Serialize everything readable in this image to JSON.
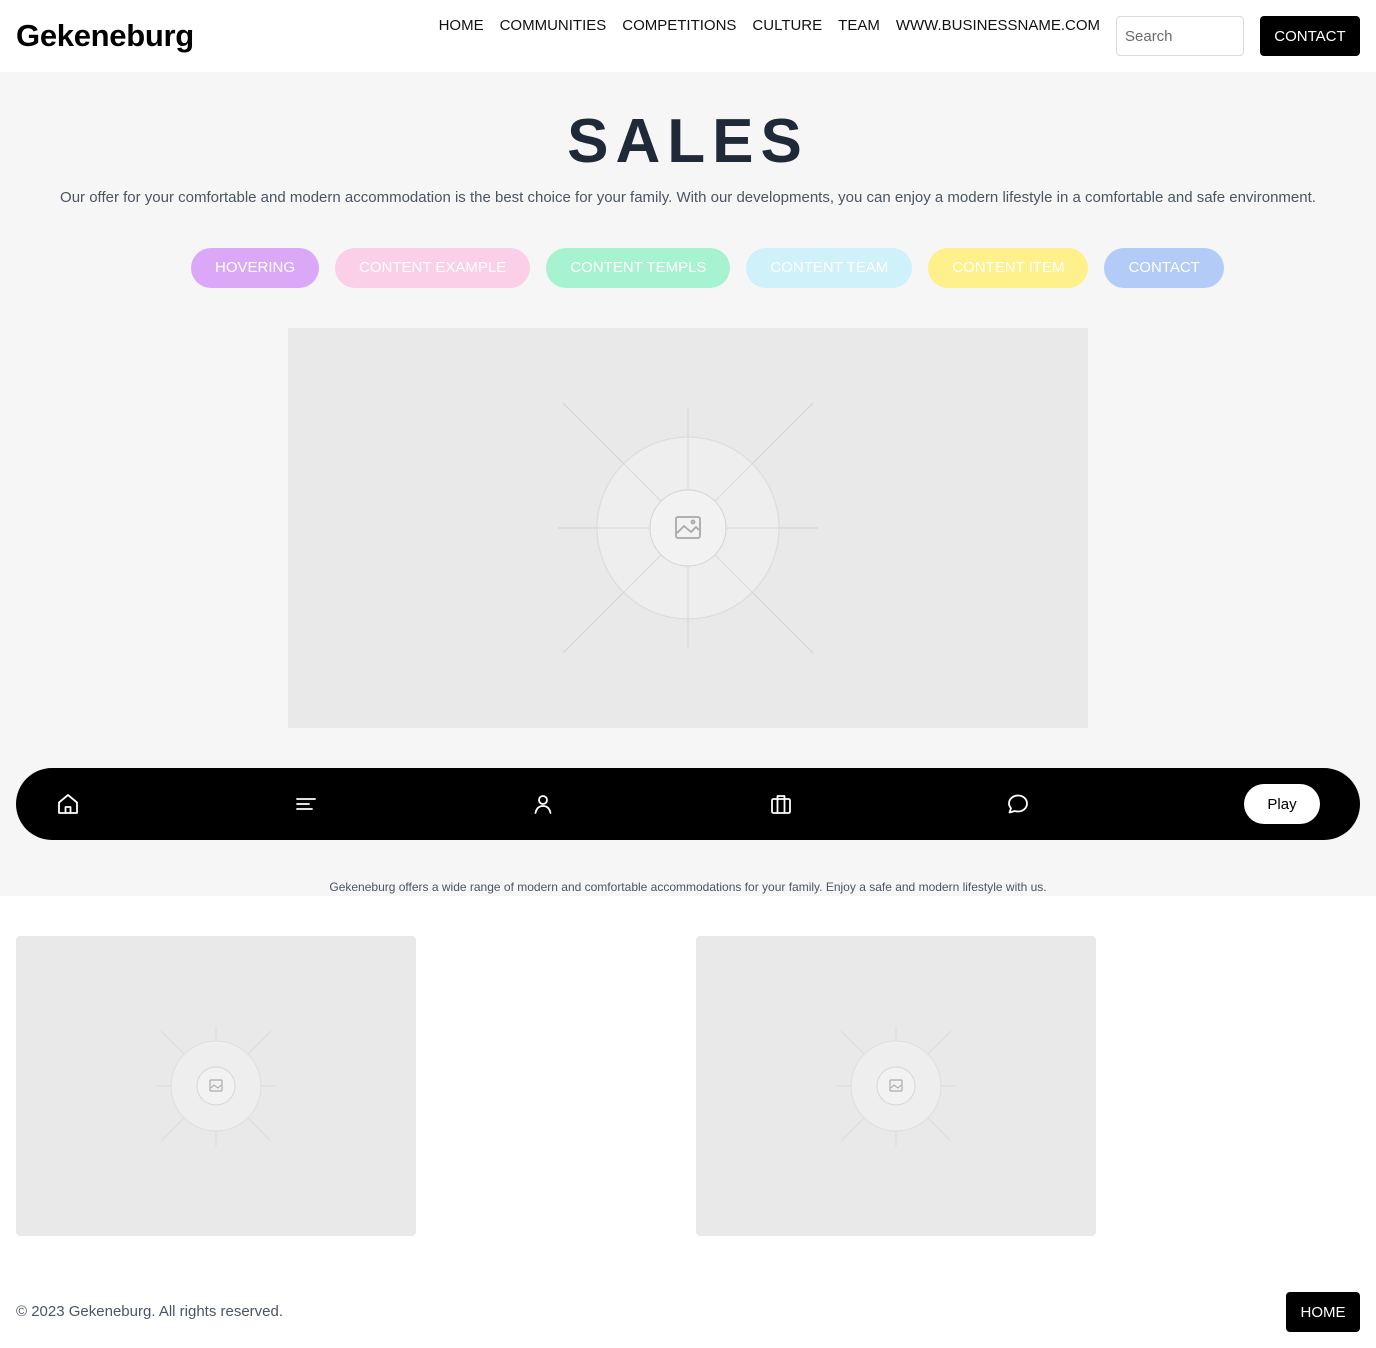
{
  "header": {
    "logo": "Gekeneburg",
    "nav": [
      "HOME",
      "COMMUNITIES",
      "COMPETITIONS",
      "CULTURE",
      "TEAM",
      "WWW.BUSINESSNAME.COM"
    ],
    "search_placeholder": "Search",
    "contact_label": "CONTACT"
  },
  "hero": {
    "title": "SALES",
    "subtitle": "Our offer for your comfortable and modern accommodation is the best choice for your family. With our developments, you can enjoy a modern lifestyle in a comfortable and safe environment.",
    "pills": [
      {
        "label": "HOVERING",
        "color": "#dba8f7"
      },
      {
        "label": "CONTENT EXAMPLE",
        "color": "#fbcfe8"
      },
      {
        "label": "CONTENT TEMPLS",
        "color": "#a7f3d0"
      },
      {
        "label": "CONTENT TEAM",
        "color": "#cff1fa"
      },
      {
        "label": "CONTENT ITEM",
        "color": "#fef08a"
      },
      {
        "label": "CONTACT",
        "color": "#b3cbf7"
      }
    ]
  },
  "bottom_bar": {
    "icons": [
      "home-icon",
      "menu-icon",
      "user-icon",
      "briefcase-icon",
      "chat-icon"
    ],
    "play_label": "Play"
  },
  "band_note": "Gekeneburg offers a wide range of modern and comfortable accommodations for your family. Enjoy a safe and modern lifestyle with us.",
  "footer": {
    "copyright": "© 2023 Gekeneburg. All rights reserved.",
    "home_label": "HOME"
  },
  "colors": {
    "band_background": "#f6f6f6",
    "placeholder": "#e9e9e9",
    "title": "#1f2937",
    "button": "#000000"
  }
}
